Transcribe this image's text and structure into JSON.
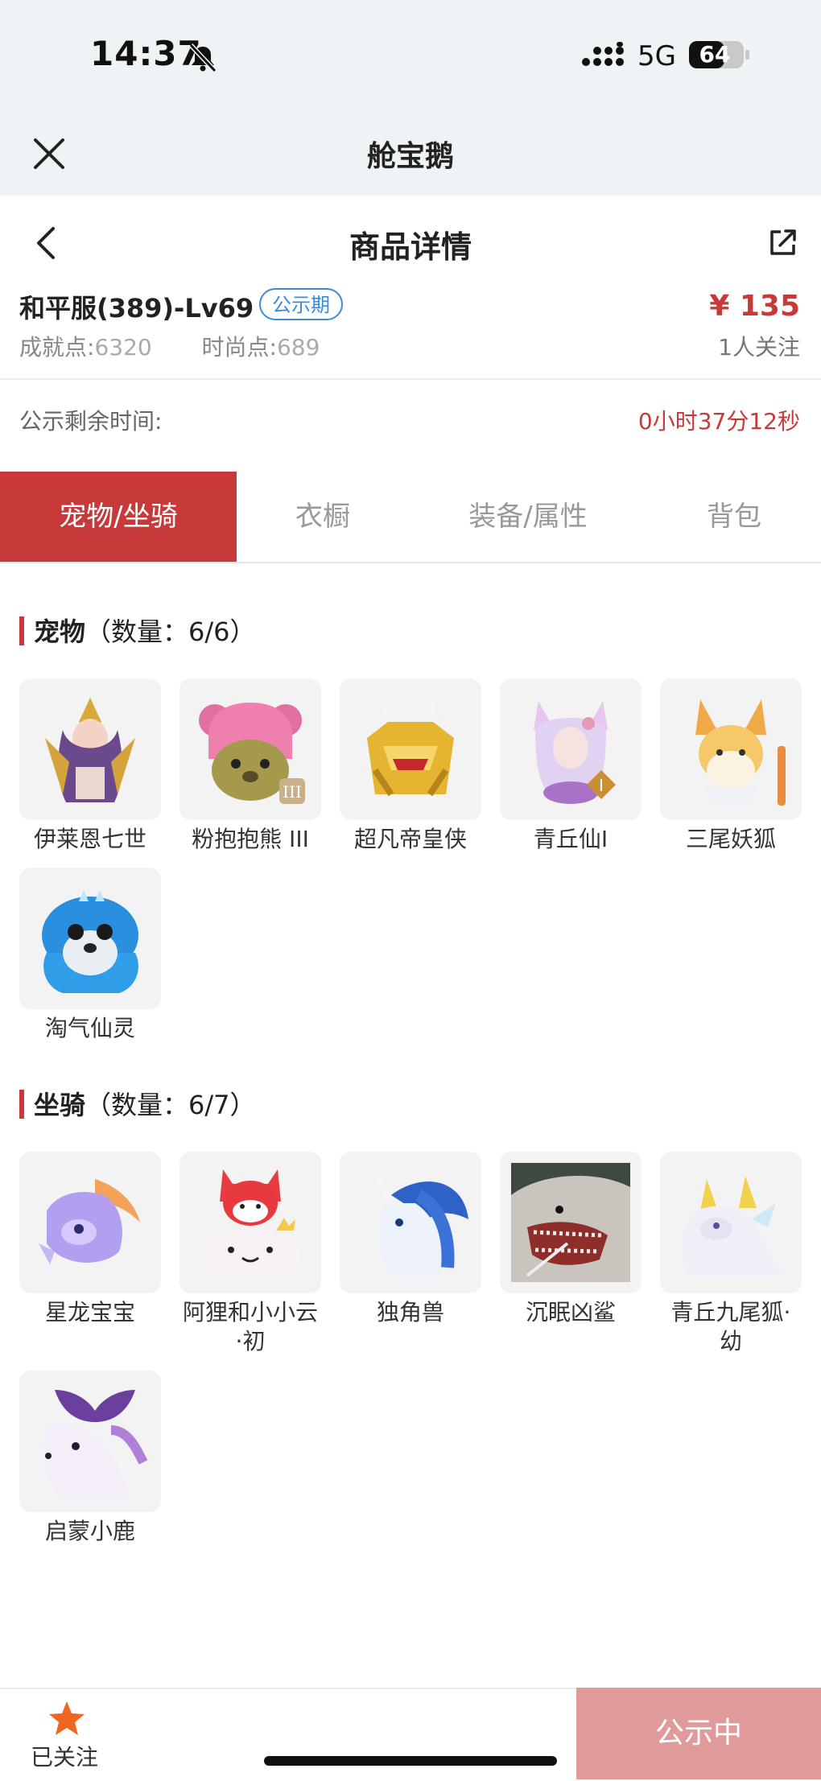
{
  "status_bar": {
    "time": "14:37",
    "network": "5G",
    "battery": "64"
  },
  "app": {
    "title": "舱宝鹅"
  },
  "page": {
    "title": "商品详情"
  },
  "product": {
    "name": "和平服(389)-Lv69",
    "badge": "公示期",
    "price": "¥ 135",
    "followers": "1人关注",
    "achievement_label": "成就点:",
    "achievement_value": "6320",
    "fashion_label": "时尚点:",
    "fashion_value": "689"
  },
  "remaining": {
    "label": "公示剩余时间:",
    "value": "0小时37分12秒"
  },
  "tabs": [
    {
      "label": "宠物/坐骑",
      "active": true
    },
    {
      "label": "衣橱",
      "active": false
    },
    {
      "label": "装备/属性",
      "active": false
    },
    {
      "label": "背包",
      "active": false
    }
  ],
  "pets": {
    "title": "宠物",
    "count": "（数量：6/6）",
    "items": [
      {
        "label": "伊莱恩七世"
      },
      {
        "label": "粉抱抱熊 III"
      },
      {
        "label": "超凡帝皇侠"
      },
      {
        "label": "青丘仙I"
      },
      {
        "label": "三尾妖狐"
      },
      {
        "label": "淘气仙灵"
      }
    ]
  },
  "mounts": {
    "title": "坐骑",
    "count": "（数量：6/7）",
    "items": [
      {
        "label": "星龙宝宝"
      },
      {
        "label": "阿狸和小小云·初"
      },
      {
        "label": "独角兽"
      },
      {
        "label": "沉眠凶鲨"
      },
      {
        "label": "青丘九尾狐·幼"
      },
      {
        "label": "启蒙小鹿"
      }
    ]
  },
  "bottom": {
    "follow_label": "已关注",
    "cta_label": "公示中"
  },
  "colors": {
    "accent": "#c83a3a",
    "badge_blue": "#3d8bd8",
    "cta": "#e09a9a",
    "header_bg": "#eef3f6"
  }
}
